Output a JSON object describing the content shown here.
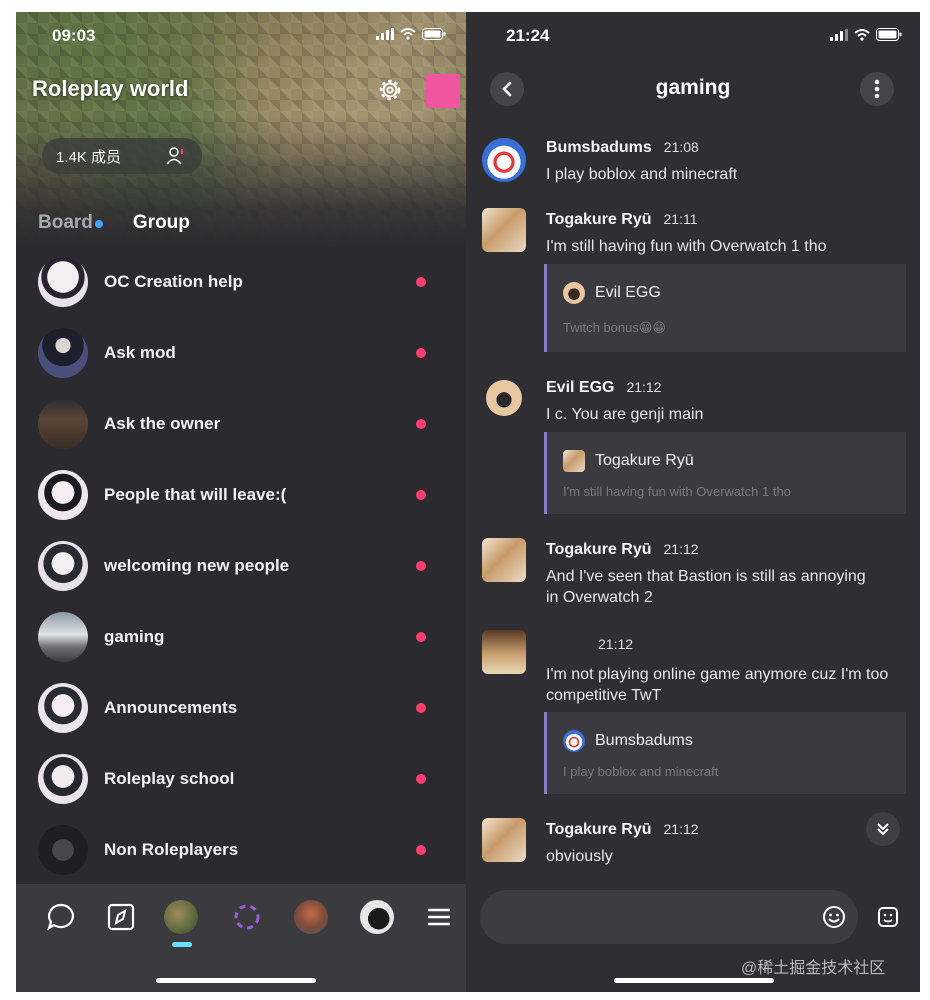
{
  "left": {
    "status_time": "09:03",
    "community_title": "Roleplay world",
    "member_count": "1.4K 成员",
    "tabs": {
      "board": "Board",
      "group": "Group"
    },
    "chats": [
      {
        "name": "OC Creation help"
      },
      {
        "name": "Ask mod"
      },
      {
        "name": "Ask the owner"
      },
      {
        "name": "People that will leave:("
      },
      {
        "name": "welcoming new people"
      },
      {
        "name": "gaming"
      },
      {
        "name": "Announcements"
      },
      {
        "name": "Roleplay school"
      },
      {
        "name": "Non Roleplayers"
      }
    ]
  },
  "right": {
    "status_time": "21:24",
    "channel_title": "gaming",
    "messages": [
      {
        "author": "Bumsbadums",
        "time": "21:08",
        "text": "I play boblox and minecraft"
      },
      {
        "author": "Togakure Ryū",
        "time": "21:11",
        "text": "I'm still having fun with Overwatch 1 tho",
        "quote": {
          "author": "Evil EGG",
          "text": "Twitch bonus😁😁"
        }
      },
      {
        "author": "Evil EGG",
        "time": "21:12",
        "text": "I c. You are genji main",
        "quote": {
          "author": "Togakure Ryū",
          "text": "I'm still having fun with Overwatch 1 tho"
        }
      },
      {
        "author": "Togakure Ryū",
        "time": "21:12",
        "text": "And I've seen that Bastion is still as annoying in Overwatch 2"
      },
      {
        "author": "",
        "time": "21:12",
        "text": "I'm not playing online game anymore cuz I'm too competitive TwT",
        "quote": {
          "author": "Bumsbadums",
          "text": "I play boblox and minecraft"
        }
      },
      {
        "author": "Togakure Ryū",
        "time": "21:12",
        "text": "obviously"
      }
    ]
  },
  "watermark": "@稀土掘金技术社区",
  "colors": {
    "unread_dot": "#ff3d6e",
    "accent_pink": "#f0569f",
    "quote_bar": "#8a7fc0",
    "nav_indicator": "#66e0ff"
  }
}
